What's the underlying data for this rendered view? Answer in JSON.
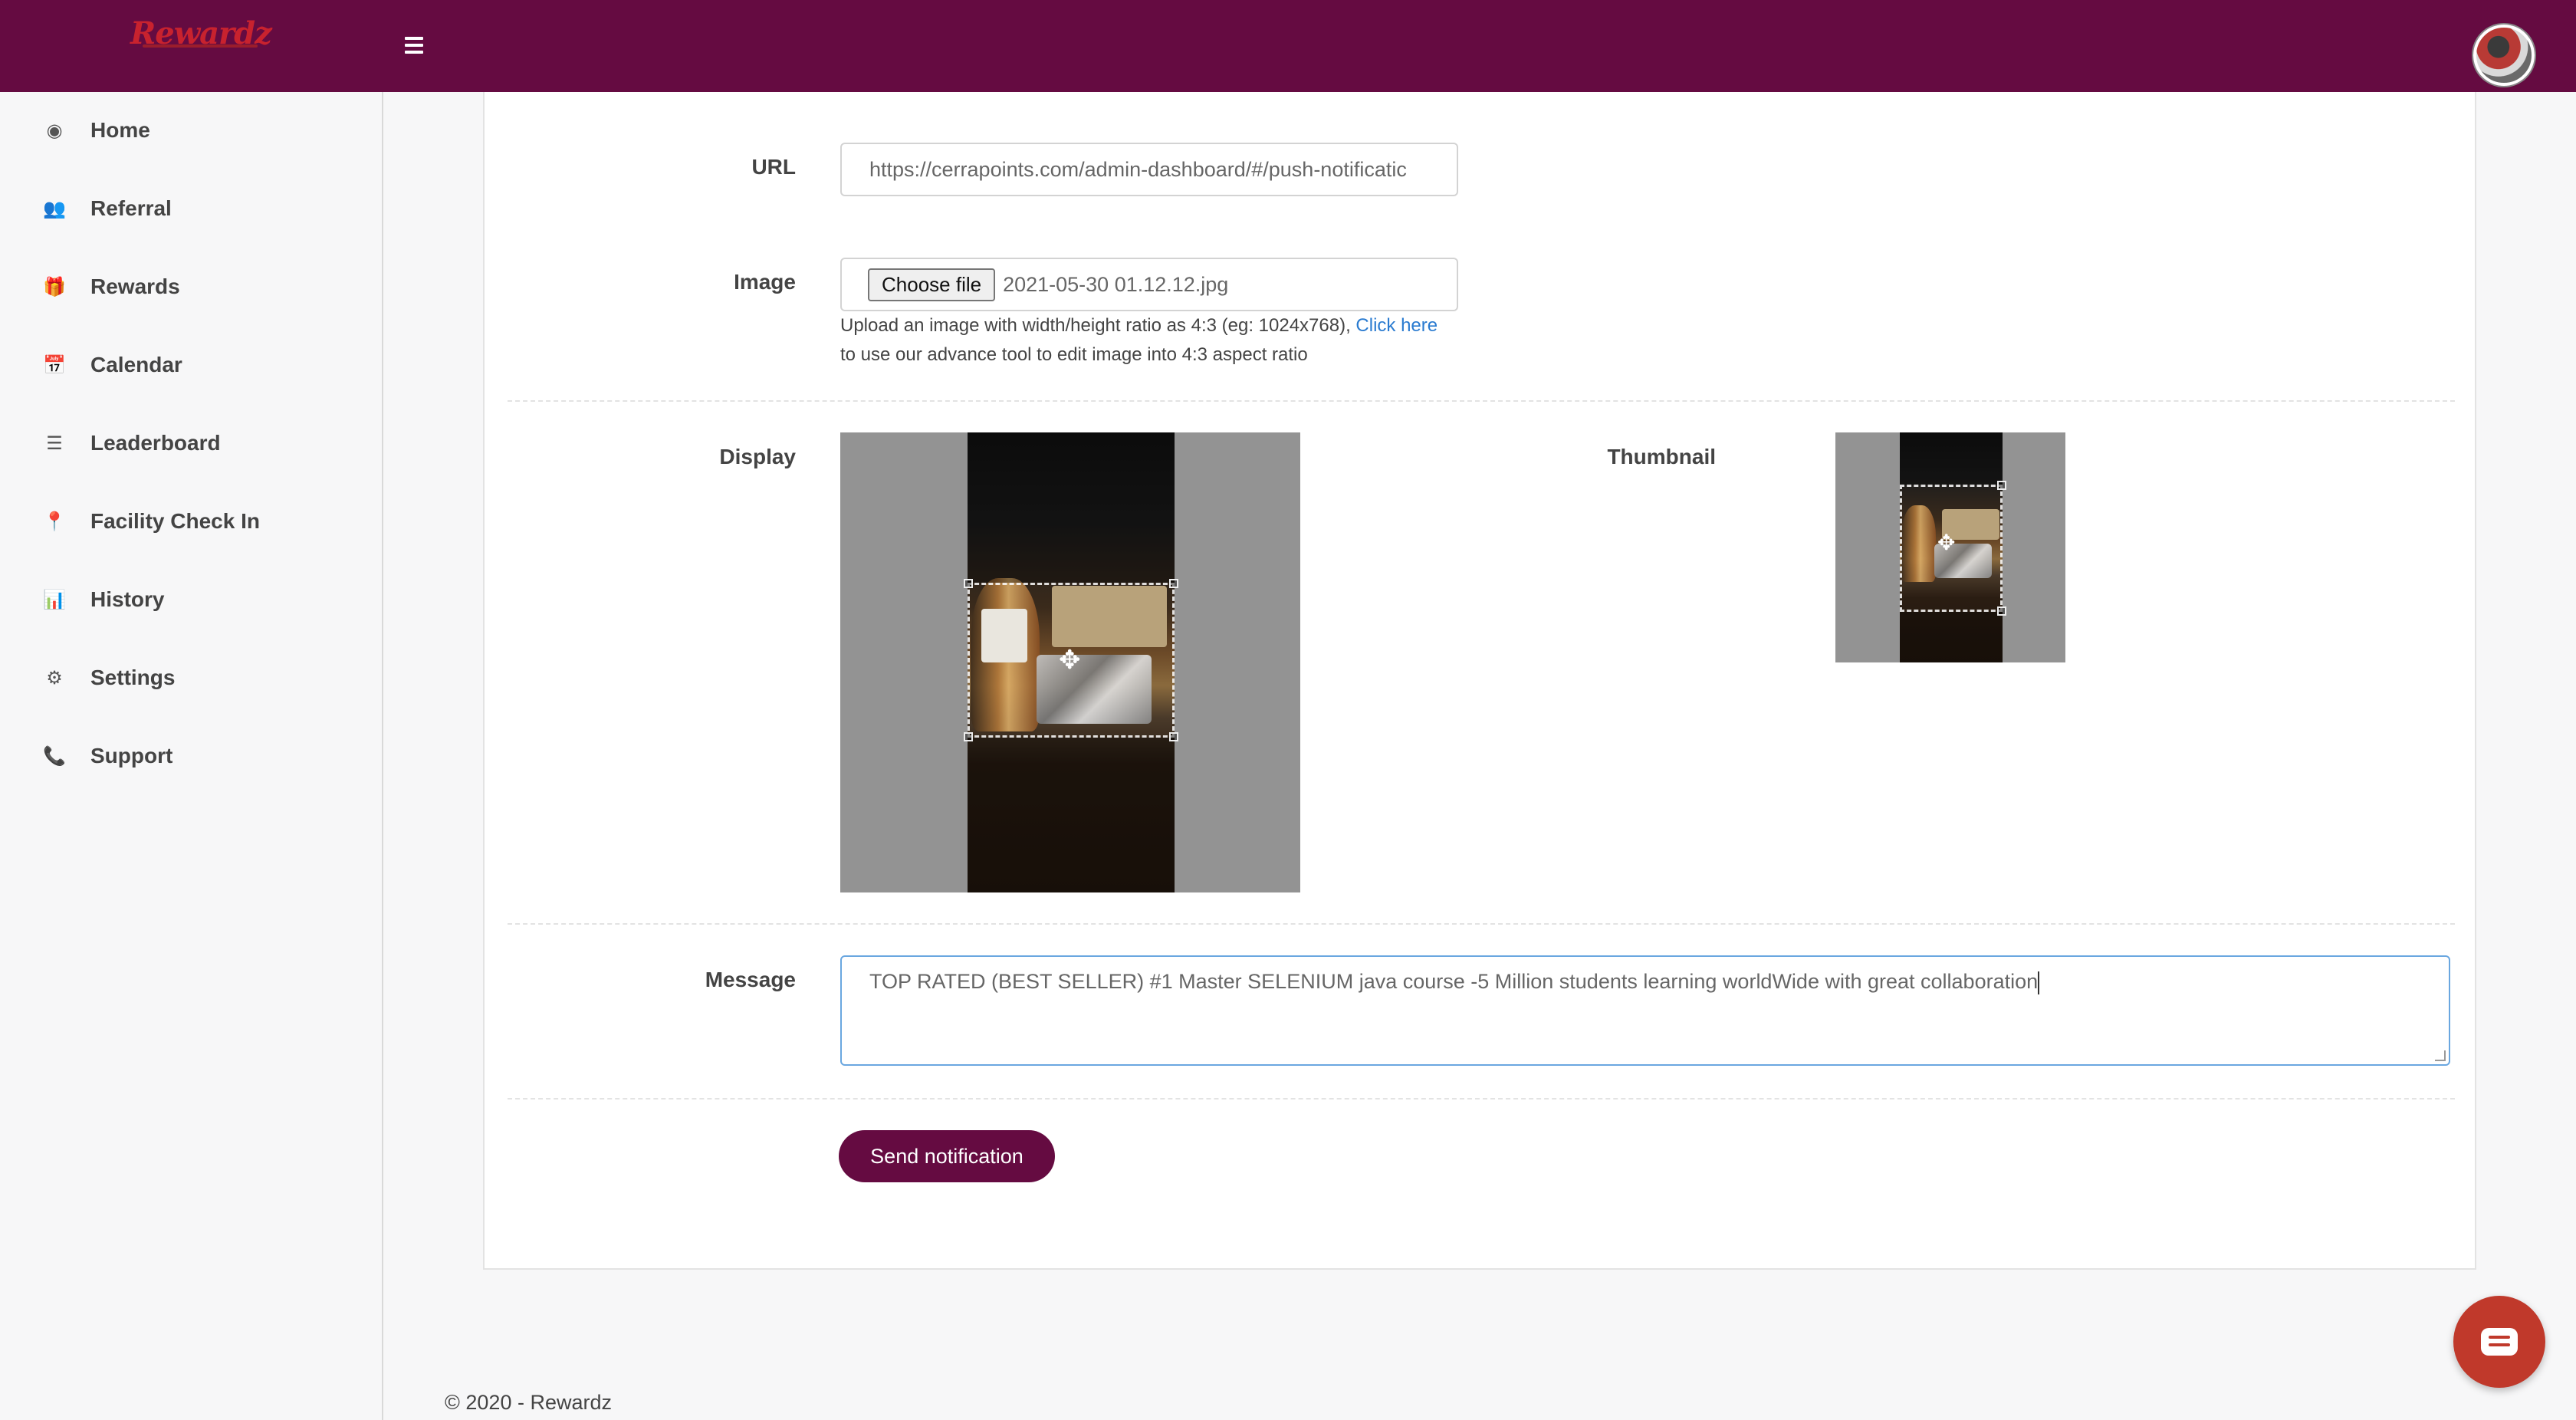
{
  "app": {
    "logo_text": "Rewardz"
  },
  "colors": {
    "brand": "#650b41",
    "link": "#2a7bd0",
    "chat": "#c0392b"
  },
  "sidebar": {
    "items": [
      {
        "label": "Home",
        "icon": "home-icon",
        "glyph": "◉"
      },
      {
        "label": "Referral",
        "icon": "users-icon",
        "glyph": "👥"
      },
      {
        "label": "Rewards",
        "icon": "gift-icon",
        "glyph": "🎁"
      },
      {
        "label": "Calendar",
        "icon": "calendar-icon",
        "glyph": "📅"
      },
      {
        "label": "Leaderboard",
        "icon": "list-icon",
        "glyph": "☰"
      },
      {
        "label": "Facility Check In",
        "icon": "map-pin-icon",
        "glyph": "📍"
      },
      {
        "label": "History",
        "icon": "bar-chart-icon",
        "glyph": "📊"
      },
      {
        "label": "Settings",
        "icon": "gear-icon",
        "glyph": "⚙"
      },
      {
        "label": "Support",
        "icon": "phone-icon",
        "glyph": "📞"
      }
    ]
  },
  "form": {
    "url": {
      "label": "URL",
      "value": "https://cerrapoints.com/admin-dashboard/#/push-notificatic"
    },
    "image": {
      "label": "Image",
      "button": "Choose file",
      "filename": "2021-05-30 01.12.12.jpg",
      "hint_prefix": "Upload an image with width/height ratio as 4:3 (eg: 1024x768), ",
      "hint_link": "Click here",
      "hint_suffix": " to use our advance tool to edit image into 4:3 aspect ratio"
    },
    "display": {
      "label": "Display"
    },
    "thumbnail": {
      "label": "Thumbnail"
    },
    "message": {
      "label": "Message",
      "value": "TOP RATED (BEST SELLER) #1 Master SELENIUM java course -5 Million students learning worldWide with great collaboration"
    },
    "submit": "Send notification"
  },
  "footer": {
    "text": "© 2020 - Rewardz"
  }
}
